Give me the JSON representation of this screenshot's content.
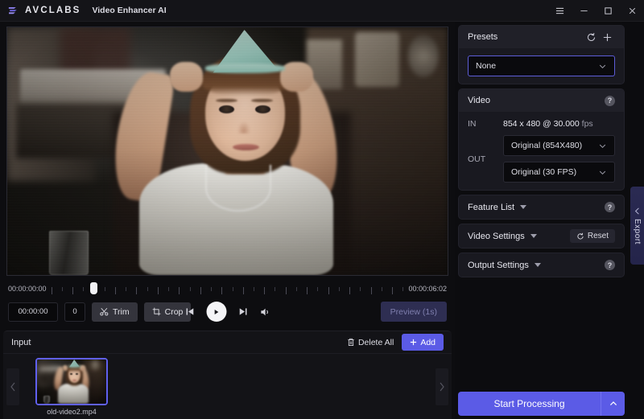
{
  "titlebar": {
    "brand": "AVCLABS",
    "app_title": "Video Enhancer AI",
    "menu_icon": "hamburger-icon",
    "minimize_icon": "minimize-icon",
    "maximize_icon": "maximize-icon",
    "close_icon": "close-icon"
  },
  "preview": {
    "scene_description": "old home-video frame of a child wearing a mint party hat, hands raised to head"
  },
  "timeline": {
    "start_timecode": "00:00:00:00",
    "end_timecode": "00:00:06:02",
    "playhead_percent": 11,
    "tick_count": 34
  },
  "controls": {
    "current_time": "00:00:00",
    "current_frame": "0",
    "trim_label": "Trim",
    "trim_icon": "scissors-icon",
    "crop_label": "Crop",
    "crop_icon": "crop-icon",
    "prev_frame_icon": "skip-previous-icon",
    "play_icon": "play-icon",
    "next_frame_icon": "skip-next-icon",
    "volume_icon": "volume-icon",
    "preview_label": "Preview (1s)"
  },
  "input": {
    "title": "Input",
    "delete_all_label": "Delete All",
    "delete_all_icon": "trash-icon",
    "add_label": "Add",
    "add_icon": "plus-icon",
    "prev_arrow_icon": "chevron-left-icon",
    "next_arrow_icon": "chevron-right-icon",
    "items": [
      {
        "filename": "old-video2.mp4",
        "selected": true
      }
    ]
  },
  "presets": {
    "title": "Presets",
    "refresh_icon": "refresh-icon",
    "add_icon": "plus-icon",
    "selected": "None",
    "chevron_icon": "chevron-down-icon"
  },
  "video": {
    "title": "Video",
    "help_icon": "question-icon",
    "in_label": "IN",
    "in_resolution": "854 x 480",
    "in_separator_left": "x",
    "in_fps": "@ 30.000",
    "in_fps_unit": "fps",
    "in_value_full": "854 x 480 @ 30.000 fps",
    "out_label": "OUT",
    "out_resolution": "Original (854X480)",
    "out_framerate": "Original (30 FPS)"
  },
  "sections": {
    "feature_list": "Feature List",
    "video_settings": "Video Settings",
    "output_settings": "Output Settings",
    "reset_label": "Reset",
    "reset_icon": "refresh-icon",
    "help_icon": "question-icon",
    "caret_icon": "caret-down-icon"
  },
  "export_tab": {
    "label": "Export",
    "chevron_icon": "chevron-left-icon"
  },
  "footer": {
    "start_label": "Start Processing",
    "caret_icon": "chevron-up-icon"
  },
  "colors": {
    "accent_purple": "#5b5be6",
    "panel_bg": "#191920",
    "window_bg": "#0d0d10",
    "titlebar_bg": "#141418",
    "export_tab_bg": "#2a2a52"
  }
}
